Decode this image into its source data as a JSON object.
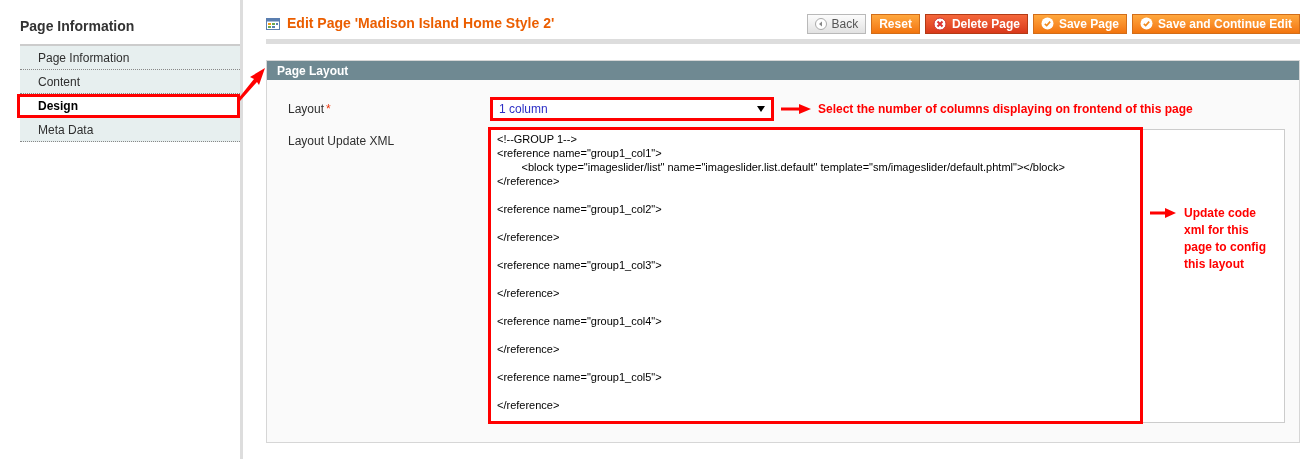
{
  "sidebar": {
    "title": "Page Information",
    "items": [
      {
        "label": "Page Information",
        "selected": false,
        "highlighted": false
      },
      {
        "label": "Content",
        "selected": false,
        "highlighted": false
      },
      {
        "label": "Design",
        "selected": true,
        "highlighted": true
      },
      {
        "label": "Meta Data",
        "selected": false,
        "highlighted": false
      }
    ]
  },
  "header": {
    "title": "Edit Page 'Madison Island Home Style 2'",
    "buttons": [
      {
        "label": "Back",
        "kind": "back"
      },
      {
        "label": "Reset",
        "kind": "plain"
      },
      {
        "label": "Delete Page",
        "kind": "delete"
      },
      {
        "label": "Save Page",
        "kind": "save"
      },
      {
        "label": "Save and Continue Edit",
        "kind": "save"
      }
    ]
  },
  "panel": {
    "title": "Page Layout",
    "layout": {
      "label": "Layout",
      "required_mark": "*",
      "value": "1 column",
      "highlighted": true,
      "note": "Select the number of columns displaying on frontend of this page"
    },
    "xml": {
      "label": "Layout Update XML",
      "highlighted": true,
      "note": "Update code xml for this page to config this layout",
      "paragraphs": [
        [
          "<!--GROUP 1-->",
          "<reference name=\"group1_col1\">",
          "\t<block type=\"imageslider/list\" name=\"imageslider.list.default\" template=\"sm/imageslider/default.phtml\"></block>",
          "</reference>"
        ],
        [
          "<reference name=\"group1_col2\">"
        ],
        [
          "</reference>"
        ],
        [
          "<reference name=\"group1_col3\">"
        ],
        [
          "</reference>"
        ],
        [
          "<reference name=\"group1_col4\">"
        ],
        [
          "</reference>"
        ],
        [
          "<reference name=\"group1_col5\">"
        ],
        [
          "</reference>"
        ]
      ]
    }
  }
}
